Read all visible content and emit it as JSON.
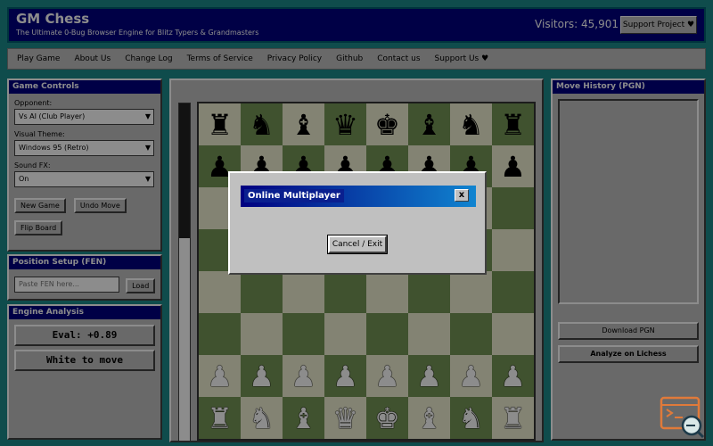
{
  "header": {
    "title": "GM Chess",
    "tagline": "The Ultimate 0-Bug Browser Engine for Blitz Typers & Grandmasters",
    "visitors": "Visitors: 45,901",
    "support_button": "Support Project ♥"
  },
  "nav": [
    "Play Game",
    "About Us",
    "Change Log",
    "Terms of Service",
    "Privacy Policy",
    "Github",
    "Contact us",
    "Support Us ♥"
  ],
  "game_controls": {
    "title": "Game Controls",
    "opponent_label": "Opponent:",
    "opponent_value": "Vs AI (Club Player)",
    "theme_label": "Visual Theme:",
    "theme_value": "Windows 95 (Retro)",
    "sound_label": "Sound FX:",
    "sound_value": "On",
    "new_game": "New Game",
    "undo_move": "Undo Move",
    "flip_board": "Flip Board"
  },
  "position_setup": {
    "title": "Position Setup (FEN)",
    "placeholder": "Paste FEN here...",
    "load": "Load"
  },
  "engine_analysis": {
    "title": "Engine Analysis",
    "eval": "Eval: +0.89",
    "to_move": "White to move"
  },
  "eval_bar": {
    "black_fraction": 0.4
  },
  "board": {
    "ranks": [
      [
        "bR",
        "bN",
        "bB",
        "bQ",
        "bK",
        "bB",
        "bN",
        "bR"
      ],
      [
        "bP",
        "bP",
        "bP",
        "bP",
        "bP",
        "bP",
        "bP",
        "bP"
      ],
      [
        "",
        "",
        "",
        "",
        "",
        "",
        "",
        ""
      ],
      [
        "",
        "",
        "",
        "",
        "",
        "",
        "",
        ""
      ],
      [
        "",
        "",
        "",
        "",
        "",
        "",
        "",
        ""
      ],
      [
        "",
        "",
        "",
        "",
        "",
        "",
        "",
        ""
      ],
      [
        "wP",
        "wP",
        "wP",
        "wP",
        "wP",
        "wP",
        "wP",
        "wP"
      ],
      [
        "wR",
        "wN",
        "wB",
        "wQ",
        "wK",
        "wB",
        "wN",
        "wR"
      ]
    ]
  },
  "move_history": {
    "title": "Move History (PGN)",
    "download": "Download PGN",
    "analyze": "Analyze on Lichess"
  },
  "dialog": {
    "title": "Online Multiplayer",
    "close": "x",
    "cancel": "Cancel / Exit"
  },
  "colors": {
    "background": "#1d8a8a",
    "title_bar": "#000080",
    "light_square": "#eeeed2",
    "dark_square": "#769656"
  }
}
